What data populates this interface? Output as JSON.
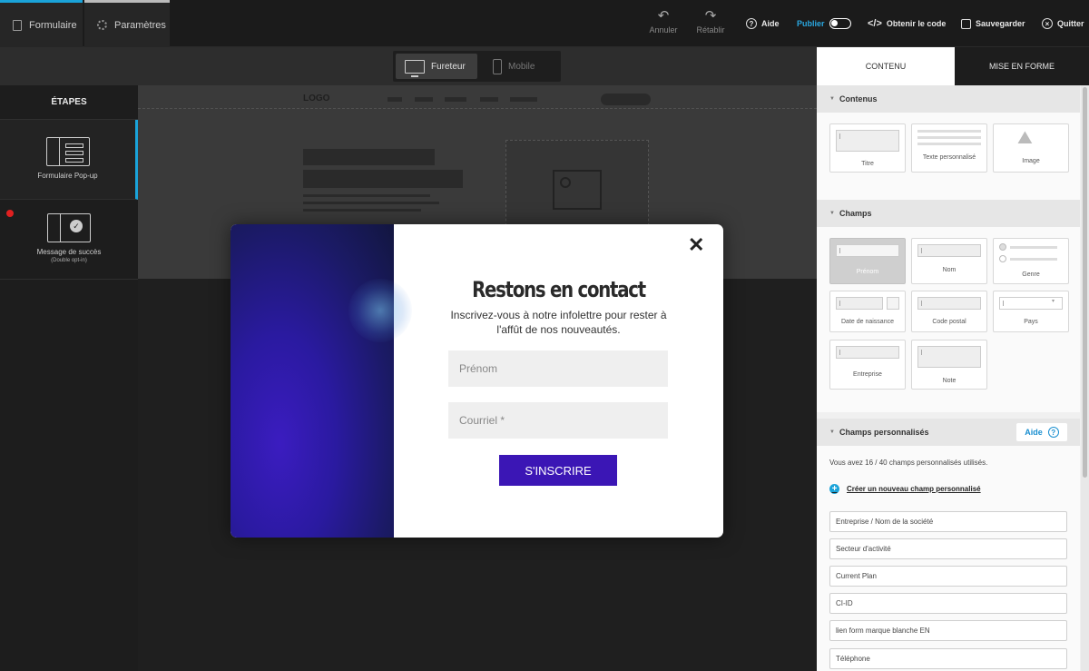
{
  "topbar": {
    "tabs": [
      {
        "label": "Formulaire",
        "icon": "document-icon"
      },
      {
        "label": "Paramètres",
        "icon": "gear-icon"
      }
    ],
    "undo_label": "Annuler",
    "redo_label": "Rétablir",
    "help_label": "Aide",
    "publish_label": "Publier",
    "get_code_label": "Obtenir le code",
    "save_label": "Sauvegarder",
    "quit_label": "Quitter"
  },
  "device": {
    "desktop_label": "Fureteur",
    "mobile_label": "Mobile",
    "selected": "desktop"
  },
  "steps": {
    "title": "ÉTAPES",
    "items": [
      {
        "label": "Formulaire Pop-up",
        "sublabel": ""
      },
      {
        "label": "Message de succès",
        "sublabel": "(Double opt-in)"
      }
    ]
  },
  "canvas": {
    "ghost_logo": "LOGO",
    "modal": {
      "title": "Restons en contact",
      "subtitle": "Inscrivez-vous à notre infolettre pour rester à l'affût de nos nouveautés.",
      "firstname_placeholder": "Prénom",
      "email_placeholder": "Courriel *",
      "submit_label": "S'INSCRIRE",
      "accent_color": "#3b16b5"
    }
  },
  "panel": {
    "tabs": [
      {
        "label": "CONTENU",
        "active": true
      },
      {
        "label": "MISE EN FORME",
        "active": false
      }
    ],
    "contents": {
      "title": "Contenus",
      "tiles": [
        "Titre",
        "Texte personnalisé",
        "Image"
      ]
    },
    "fields": {
      "title": "Champs",
      "tiles": [
        "Prénom",
        "Nom",
        "Genre",
        "Date de naissance",
        "Code postal",
        "Pays",
        "Entreprise",
        "Note"
      ]
    },
    "custom": {
      "title": "Champs personnalisés",
      "help_label": "Aide",
      "usage": "Vous avez 16 / 40 champs personnalisés utilisés.",
      "create_label": "Créer un nouveau champ personnalisé",
      "items": [
        "Entreprise / Nom de la société",
        "Secteur d'activité",
        "Current Plan",
        "CI-ID",
        "lien form marque blanche EN",
        "Téléphone"
      ]
    }
  }
}
